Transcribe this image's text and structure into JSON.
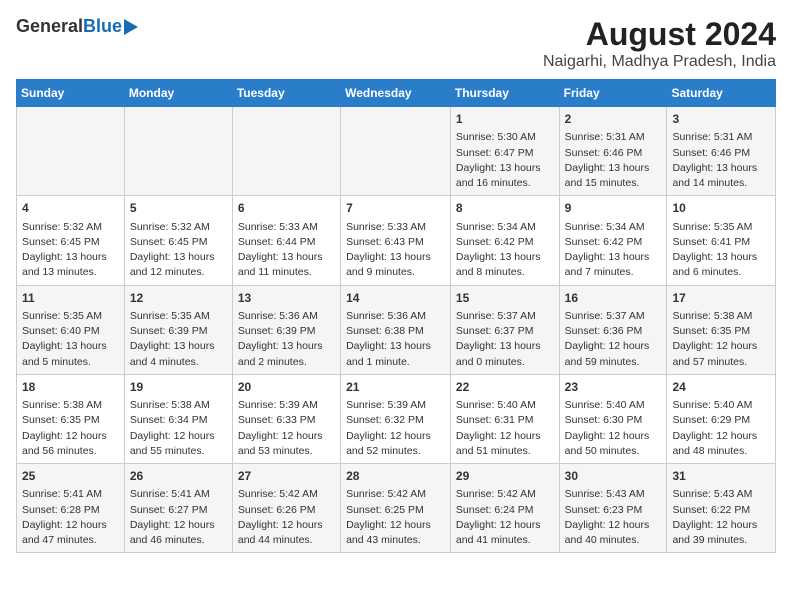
{
  "logo": {
    "general": "General",
    "blue": "Blue"
  },
  "title": "August 2024",
  "subtitle": "Naigarhi, Madhya Pradesh, India",
  "headers": [
    "Sunday",
    "Monday",
    "Tuesday",
    "Wednesday",
    "Thursday",
    "Friday",
    "Saturday"
  ],
  "weeks": [
    [
      {
        "day": "",
        "text": ""
      },
      {
        "day": "",
        "text": ""
      },
      {
        "day": "",
        "text": ""
      },
      {
        "day": "",
        "text": ""
      },
      {
        "day": "1",
        "text": "Sunrise: 5:30 AM\nSunset: 6:47 PM\nDaylight: 13 hours and 16 minutes."
      },
      {
        "day": "2",
        "text": "Sunrise: 5:31 AM\nSunset: 6:46 PM\nDaylight: 13 hours and 15 minutes."
      },
      {
        "day": "3",
        "text": "Sunrise: 5:31 AM\nSunset: 6:46 PM\nDaylight: 13 hours and 14 minutes."
      }
    ],
    [
      {
        "day": "4",
        "text": "Sunrise: 5:32 AM\nSunset: 6:45 PM\nDaylight: 13 hours and 13 minutes."
      },
      {
        "day": "5",
        "text": "Sunrise: 5:32 AM\nSunset: 6:45 PM\nDaylight: 13 hours and 12 minutes."
      },
      {
        "day": "6",
        "text": "Sunrise: 5:33 AM\nSunset: 6:44 PM\nDaylight: 13 hours and 11 minutes."
      },
      {
        "day": "7",
        "text": "Sunrise: 5:33 AM\nSunset: 6:43 PM\nDaylight: 13 hours and 9 minutes."
      },
      {
        "day": "8",
        "text": "Sunrise: 5:34 AM\nSunset: 6:42 PM\nDaylight: 13 hours and 8 minutes."
      },
      {
        "day": "9",
        "text": "Sunrise: 5:34 AM\nSunset: 6:42 PM\nDaylight: 13 hours and 7 minutes."
      },
      {
        "day": "10",
        "text": "Sunrise: 5:35 AM\nSunset: 6:41 PM\nDaylight: 13 hours and 6 minutes."
      }
    ],
    [
      {
        "day": "11",
        "text": "Sunrise: 5:35 AM\nSunset: 6:40 PM\nDaylight: 13 hours and 5 minutes."
      },
      {
        "day": "12",
        "text": "Sunrise: 5:35 AM\nSunset: 6:39 PM\nDaylight: 13 hours and 4 minutes."
      },
      {
        "day": "13",
        "text": "Sunrise: 5:36 AM\nSunset: 6:39 PM\nDaylight: 13 hours and 2 minutes."
      },
      {
        "day": "14",
        "text": "Sunrise: 5:36 AM\nSunset: 6:38 PM\nDaylight: 13 hours and 1 minute."
      },
      {
        "day": "15",
        "text": "Sunrise: 5:37 AM\nSunset: 6:37 PM\nDaylight: 13 hours and 0 minutes."
      },
      {
        "day": "16",
        "text": "Sunrise: 5:37 AM\nSunset: 6:36 PM\nDaylight: 12 hours and 59 minutes."
      },
      {
        "day": "17",
        "text": "Sunrise: 5:38 AM\nSunset: 6:35 PM\nDaylight: 12 hours and 57 minutes."
      }
    ],
    [
      {
        "day": "18",
        "text": "Sunrise: 5:38 AM\nSunset: 6:35 PM\nDaylight: 12 hours and 56 minutes."
      },
      {
        "day": "19",
        "text": "Sunrise: 5:38 AM\nSunset: 6:34 PM\nDaylight: 12 hours and 55 minutes."
      },
      {
        "day": "20",
        "text": "Sunrise: 5:39 AM\nSunset: 6:33 PM\nDaylight: 12 hours and 53 minutes."
      },
      {
        "day": "21",
        "text": "Sunrise: 5:39 AM\nSunset: 6:32 PM\nDaylight: 12 hours and 52 minutes."
      },
      {
        "day": "22",
        "text": "Sunrise: 5:40 AM\nSunset: 6:31 PM\nDaylight: 12 hours and 51 minutes."
      },
      {
        "day": "23",
        "text": "Sunrise: 5:40 AM\nSunset: 6:30 PM\nDaylight: 12 hours and 50 minutes."
      },
      {
        "day": "24",
        "text": "Sunrise: 5:40 AM\nSunset: 6:29 PM\nDaylight: 12 hours and 48 minutes."
      }
    ],
    [
      {
        "day": "25",
        "text": "Sunrise: 5:41 AM\nSunset: 6:28 PM\nDaylight: 12 hours and 47 minutes."
      },
      {
        "day": "26",
        "text": "Sunrise: 5:41 AM\nSunset: 6:27 PM\nDaylight: 12 hours and 46 minutes."
      },
      {
        "day": "27",
        "text": "Sunrise: 5:42 AM\nSunset: 6:26 PM\nDaylight: 12 hours and 44 minutes."
      },
      {
        "day": "28",
        "text": "Sunrise: 5:42 AM\nSunset: 6:25 PM\nDaylight: 12 hours and 43 minutes."
      },
      {
        "day": "29",
        "text": "Sunrise: 5:42 AM\nSunset: 6:24 PM\nDaylight: 12 hours and 41 minutes."
      },
      {
        "day": "30",
        "text": "Sunrise: 5:43 AM\nSunset: 6:23 PM\nDaylight: 12 hours and 40 minutes."
      },
      {
        "day": "31",
        "text": "Sunrise: 5:43 AM\nSunset: 6:22 PM\nDaylight: 12 hours and 39 minutes."
      }
    ]
  ]
}
